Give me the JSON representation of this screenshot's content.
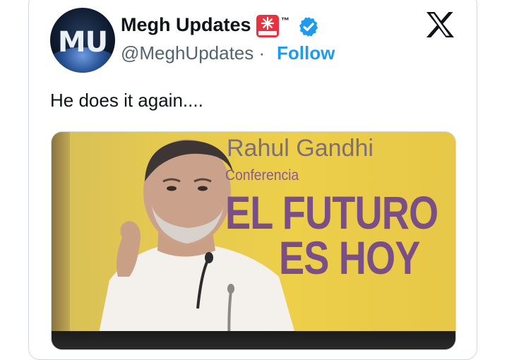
{
  "author": {
    "display_name": "Megh Updates",
    "avatar_text": "MU",
    "tm_mark": "™",
    "handle": "@MeghUpdates",
    "separator": "·",
    "follow_label": "Follow",
    "verified": true
  },
  "tweet": {
    "text": "He does it again...."
  },
  "media": {
    "overlay_name": "Rahul Gandhi",
    "overlay_subtitle": "Conferencia",
    "overlay_line1": "EL FUTURO",
    "overlay_line2": "ES HOY"
  },
  "colors": {
    "follow_blue": "#1d9bf0",
    "verified_blue": "#1d9bf0",
    "handle_gray": "#536471",
    "poster_yellow": "#edcf4a",
    "poster_purple": "#7a4e86"
  },
  "icons": [
    "siren-emoji-icon",
    "verified-badge-icon",
    "x-logo-icon"
  ]
}
